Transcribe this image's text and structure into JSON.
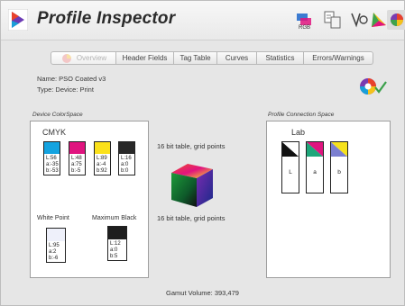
{
  "app": {
    "title": "Profile Inspector"
  },
  "toolbar": {
    "icons": [
      "profile-settings-icon",
      "convert-profile-icon",
      "verify-profile-icon",
      "gamut-plot-icon",
      "inspector-icon"
    ]
  },
  "tabs": [
    {
      "label": "Overview",
      "active": true
    },
    {
      "label": "Header Fields",
      "active": false
    },
    {
      "label": "Tag Table",
      "active": false
    },
    {
      "label": "Curves",
      "active": false
    },
    {
      "label": "Statistics",
      "active": false
    },
    {
      "label": "Errors/Warnings",
      "active": false
    }
  ],
  "profile": {
    "name_text": "Name:  PSO Coated v3",
    "type_text": "Type:  Device: Print"
  },
  "device": {
    "section_label": "Device ColorSpace",
    "colorspace": "CMYK",
    "swatches": [
      {
        "color": "#14a3e0",
        "l": "L:56",
        "a": "a:-35",
        "b": "b:-53"
      },
      {
        "color": "#e0147f",
        "l": "L:48",
        "a": "a:75",
        "b": "b:-5"
      },
      {
        "color": "#fbe11b",
        "l": "L:89",
        "a": "a:-4",
        "b": "b:92"
      },
      {
        "color": "#282828",
        "l": "L:16",
        "a": "a:0",
        "b": "b:0"
      }
    ],
    "white_point": {
      "label": "White Point",
      "color": "#eef0fa",
      "l": "L:95",
      "a": "a:2",
      "b": "b:-6"
    },
    "max_black": {
      "label": "Maximum Black",
      "color": "#1e1e1e",
      "l": "L:12",
      "a": "a:0",
      "b": "b:5"
    }
  },
  "center": {
    "top_note": "16 bit table,  grid points",
    "bottom_note": "16 bit table,  grid points"
  },
  "pcs": {
    "section_label": "Profile Connection Space",
    "colorspace": "Lab",
    "channels": [
      "L",
      "a",
      "b"
    ]
  },
  "gamut": {
    "text": "Gamut Volume:  393,479"
  }
}
